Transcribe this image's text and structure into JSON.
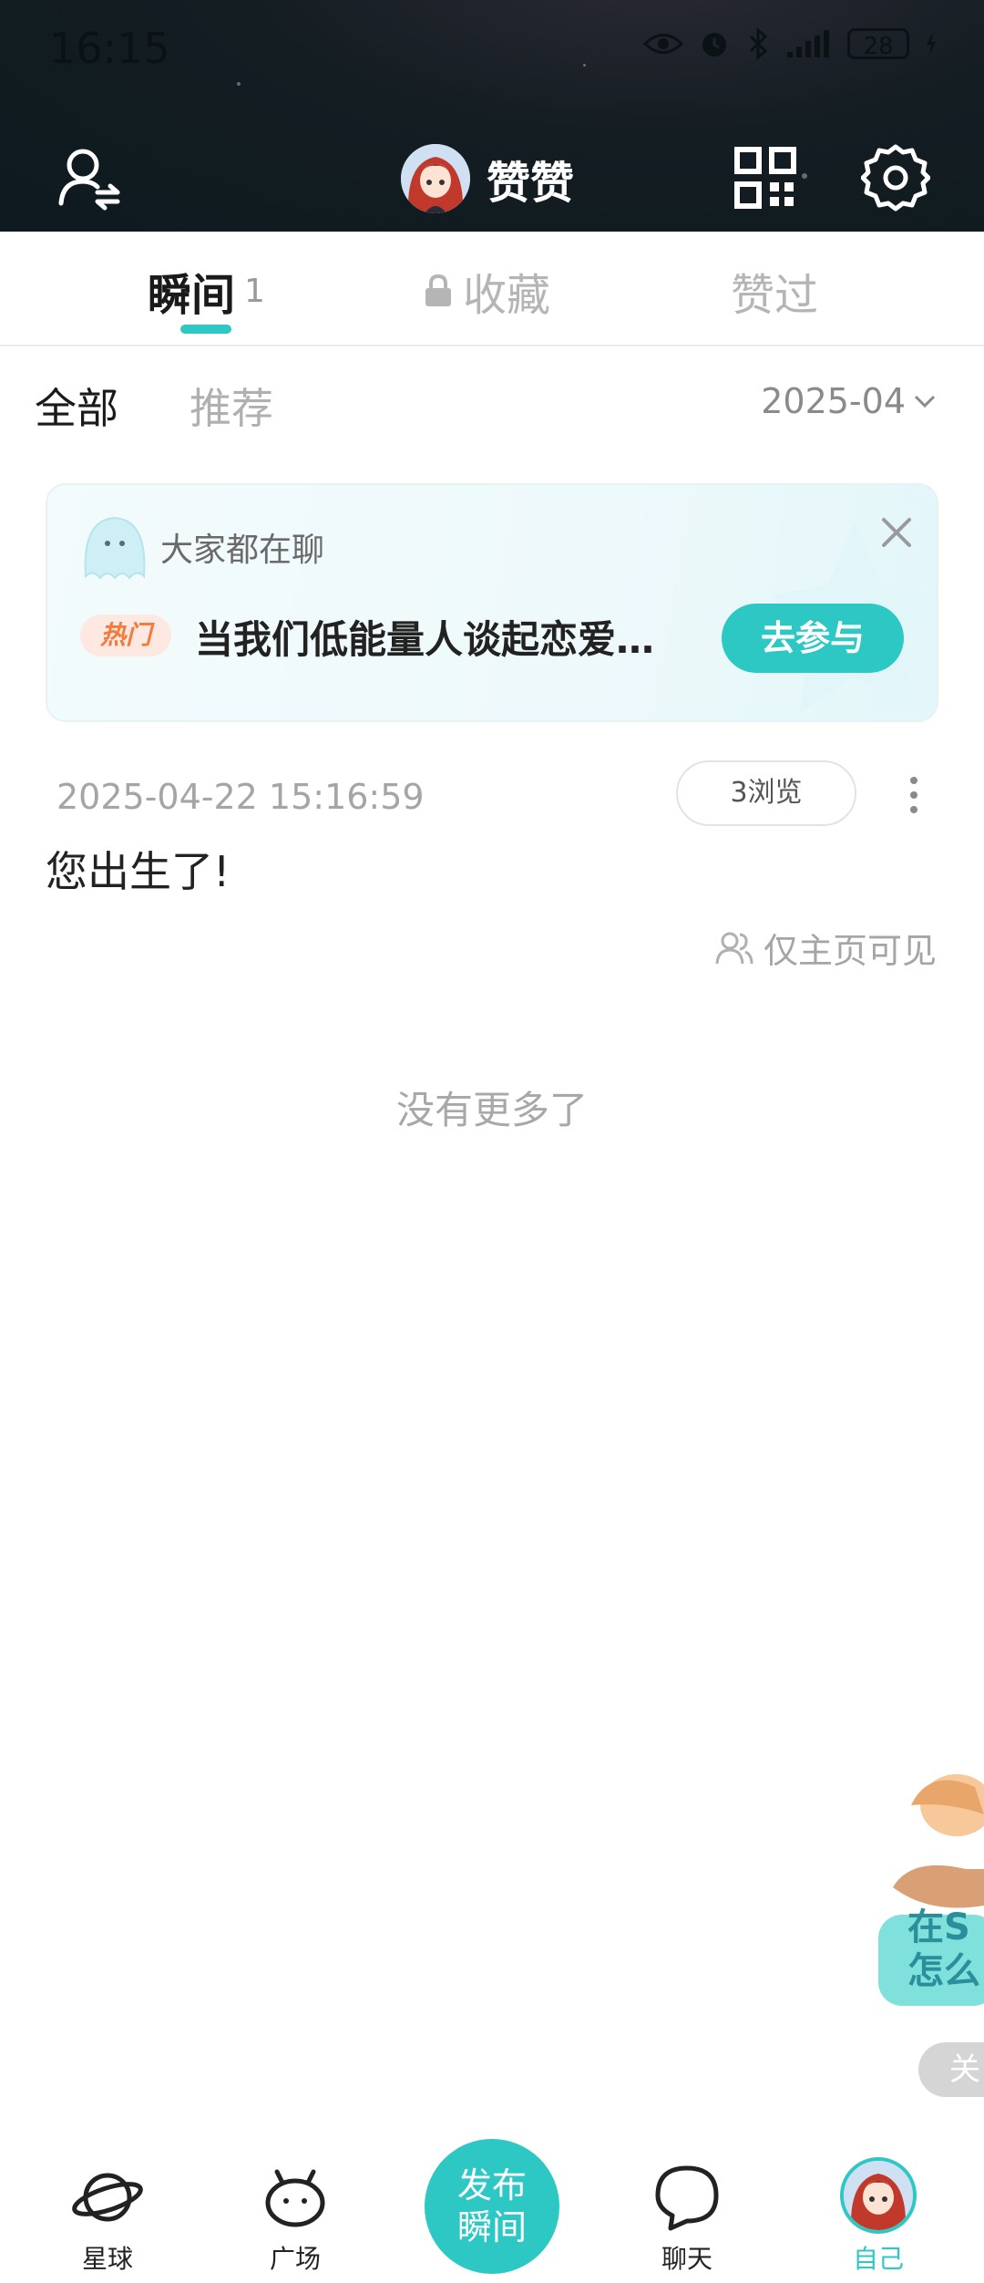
{
  "status_bar": {
    "time": "16:15",
    "battery": "28"
  },
  "header": {
    "username": "赞赞"
  },
  "tabs": [
    {
      "label": "瞬间",
      "count": "1"
    },
    {
      "label": "收藏"
    },
    {
      "label": "赞过"
    }
  ],
  "filters": {
    "all": "全部",
    "recommend": "推荐",
    "date": "2025-04"
  },
  "banner": {
    "label": "大家都在聊",
    "badge": "热门",
    "topic": "当我们低能量人谈起恋爱…",
    "join": "去参与"
  },
  "post": {
    "timestamp": "2025-04-22 15:16:59",
    "views": "3浏览",
    "text": "您出生了!",
    "visibility": "仅主页可见"
  },
  "footer_text": "没有更多了",
  "promo": {
    "line1": "在S",
    "line2": "怎么",
    "close": "关"
  },
  "bottom_nav": {
    "planet": "星球",
    "square": "广场",
    "publish_line1": "发布",
    "publish_line2": "瞬间",
    "chat": "聊天",
    "me": "自己"
  },
  "colors": {
    "accent": "#2dc8c4",
    "hot": "#f57a3c",
    "header_bg": "#0d1a1f"
  }
}
